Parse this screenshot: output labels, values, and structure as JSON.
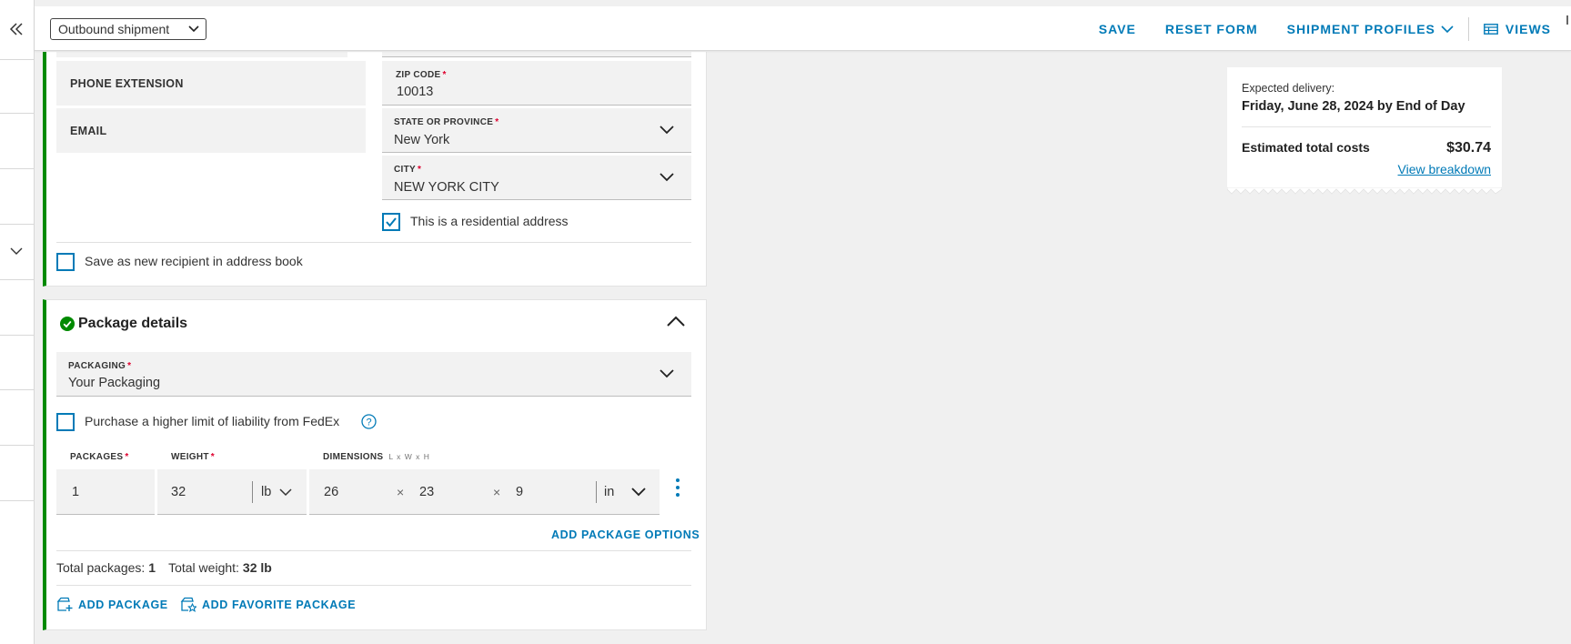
{
  "top_bar": {
    "shipment_type": "Outbound shipment",
    "save_label": "SAVE",
    "reset_label": "RESET FORM",
    "profiles_label": "SHIPMENT PROFILES",
    "views_label": "VIEWS"
  },
  "recipient": {
    "phone_extension_label": "PHONE EXTENSION",
    "email_label": "EMAIL",
    "zip_label": "ZIP CODE",
    "zip_value": "10013",
    "state_label": "STATE OR PROVINCE",
    "state_value": "New York",
    "city_label": "CITY",
    "city_value": "NEW YORK CITY",
    "residential_label": "This is a residential address",
    "residential_checked": true,
    "save_recipient_label": "Save as new recipient in address book",
    "save_recipient_checked": false
  },
  "package": {
    "title": "Package details",
    "packaging_label": "PACKAGING",
    "packaging_value": "Your Packaging",
    "liability_label": "Purchase a higher limit of liability from FedEx",
    "liability_checked": false,
    "packages_label": "PACKAGES",
    "weight_label": "WEIGHT",
    "dimensions_label": "DIMENSIONS",
    "dimensions_sub": "L x W x H",
    "packages_value": "1",
    "weight_value": "32",
    "weight_unit": "lb",
    "dim_l": "26",
    "dim_w": "23",
    "dim_h": "9",
    "times_symbol": "×",
    "dim_unit": "in",
    "add_options_label": "ADD PACKAGE OPTIONS",
    "total_packages_label": "Total packages:",
    "total_packages_value": "1",
    "total_weight_label": "Total weight:",
    "total_weight_value": "32 lb",
    "add_package_label": "ADD PACKAGE",
    "add_favorite_label": "ADD FAVORITE PACKAGE"
  },
  "summary": {
    "expected_label": "Expected delivery:",
    "expected_date": "Friday, June 28, 2024 by End of Day",
    "cost_label": "Estimated total costs",
    "cost_value": "$30.74",
    "breakdown_label": "View breakdown"
  },
  "colors": {
    "accent_blue": "#007ab7",
    "success_green": "#008a00",
    "required_red": "#de002e"
  }
}
